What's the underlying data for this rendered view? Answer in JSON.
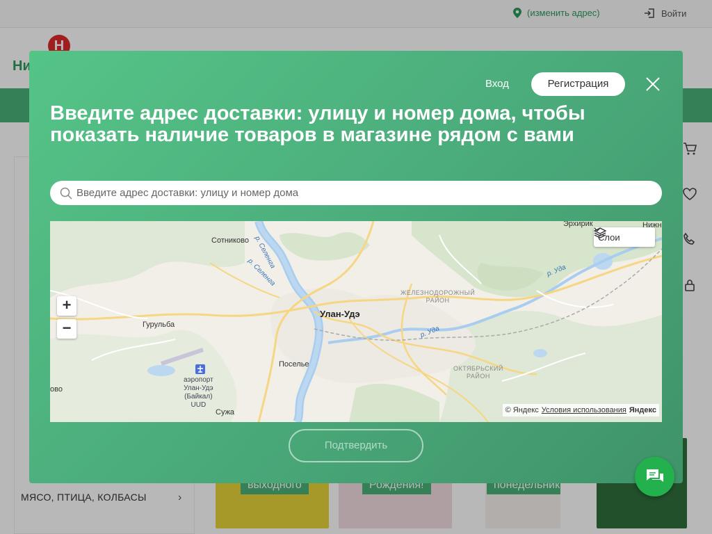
{
  "topbar": {
    "change_address": "(изменить адрес)",
    "login": "Войти"
  },
  "header": {
    "logo_letter": "Н",
    "logo_text": "Ни"
  },
  "sidebar": {
    "category": "МЯСО, ПТИЦА, КОЛБАСЫ"
  },
  "promos": [
    {
      "tag": "выходного"
    },
    {
      "tag": "Рождения!"
    },
    {
      "tag": "понедельник"
    }
  ],
  "modal": {
    "login_label": "Вход",
    "register_label": "Регистрация",
    "title": "Введите адрес доставки: улицу и номер дома, чтобы показать наличие товаров в магазине рядом с вами",
    "search_placeholder": "Введите адрес доставки: улицу и номер дома",
    "confirm_label": "Подтвердить"
  },
  "map": {
    "layers_label": "Слои",
    "labels": {
      "sotnikovo": "Сотниково",
      "erkhirik": "Эрхирик",
      "nizhn": "Нижн",
      "selenga1": "р. Селенга",
      "selenga2": "р. Селенга",
      "uda1": "р. Уда",
      "uda2": "р. Уда",
      "zhd1": "ЖЕЛЕЗНОДОРОЖНЫЙ",
      "zhd2": "РАЙОН",
      "ulan_ude": "Улан-Удэ",
      "gurulba": "Гурульба",
      "poselye": "Поселье",
      "okt1": "ОКТЯБРЬСКИЙ",
      "okt2": "РАЙОН",
      "airport1": "аэропорт",
      "airport2": "Улан-Удэ",
      "airport3": "(Байкал)",
      "airport4": "UUD",
      "suzha": "Сужа",
      "ovo": "ово"
    },
    "copyright": "© Яндекс",
    "terms": "Условия использования",
    "yandex_logo": "Яндекс"
  },
  "colors": {
    "accent": "#4cb27a",
    "modal_from": "#55c487",
    "modal_to": "#3f9369",
    "chat": "#22b14c",
    "logo_red": "#e02a2a"
  }
}
